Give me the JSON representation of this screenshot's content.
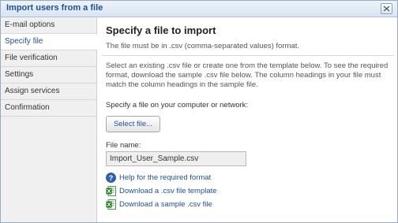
{
  "window": {
    "title": "Import users from a file"
  },
  "sidebar": {
    "items": [
      {
        "label": "E-mail options"
      },
      {
        "label": "Specify file"
      },
      {
        "label": "File verification"
      },
      {
        "label": "Settings"
      },
      {
        "label": "Assign services"
      },
      {
        "label": "Confirmation"
      }
    ],
    "active_index": 1
  },
  "main": {
    "heading": "Specify a file to import",
    "subtitle": "The file must be in .csv (comma-separated values) format.",
    "description": "Select an existing .csv file or create one from the template below. To see the required format, download the sample .csv file below. The column headings in your file must match the column headings in the sample file.",
    "specify_label": "Specify a file on your computer or network:",
    "select_button": "Select file...",
    "file_name_label": "File name:",
    "file_name_value": "Import_User_Sample.csv",
    "links": [
      {
        "label": "Help for the required format",
        "icon": "help-icon"
      },
      {
        "label": "Download a .csv file template",
        "icon": "excel-icon"
      },
      {
        "label": "Download a sample .csv file",
        "icon": "excel-icon"
      }
    ]
  },
  "colors": {
    "title_blue": "#1f4f94",
    "sidebar_bg": "#f0f0f0"
  }
}
